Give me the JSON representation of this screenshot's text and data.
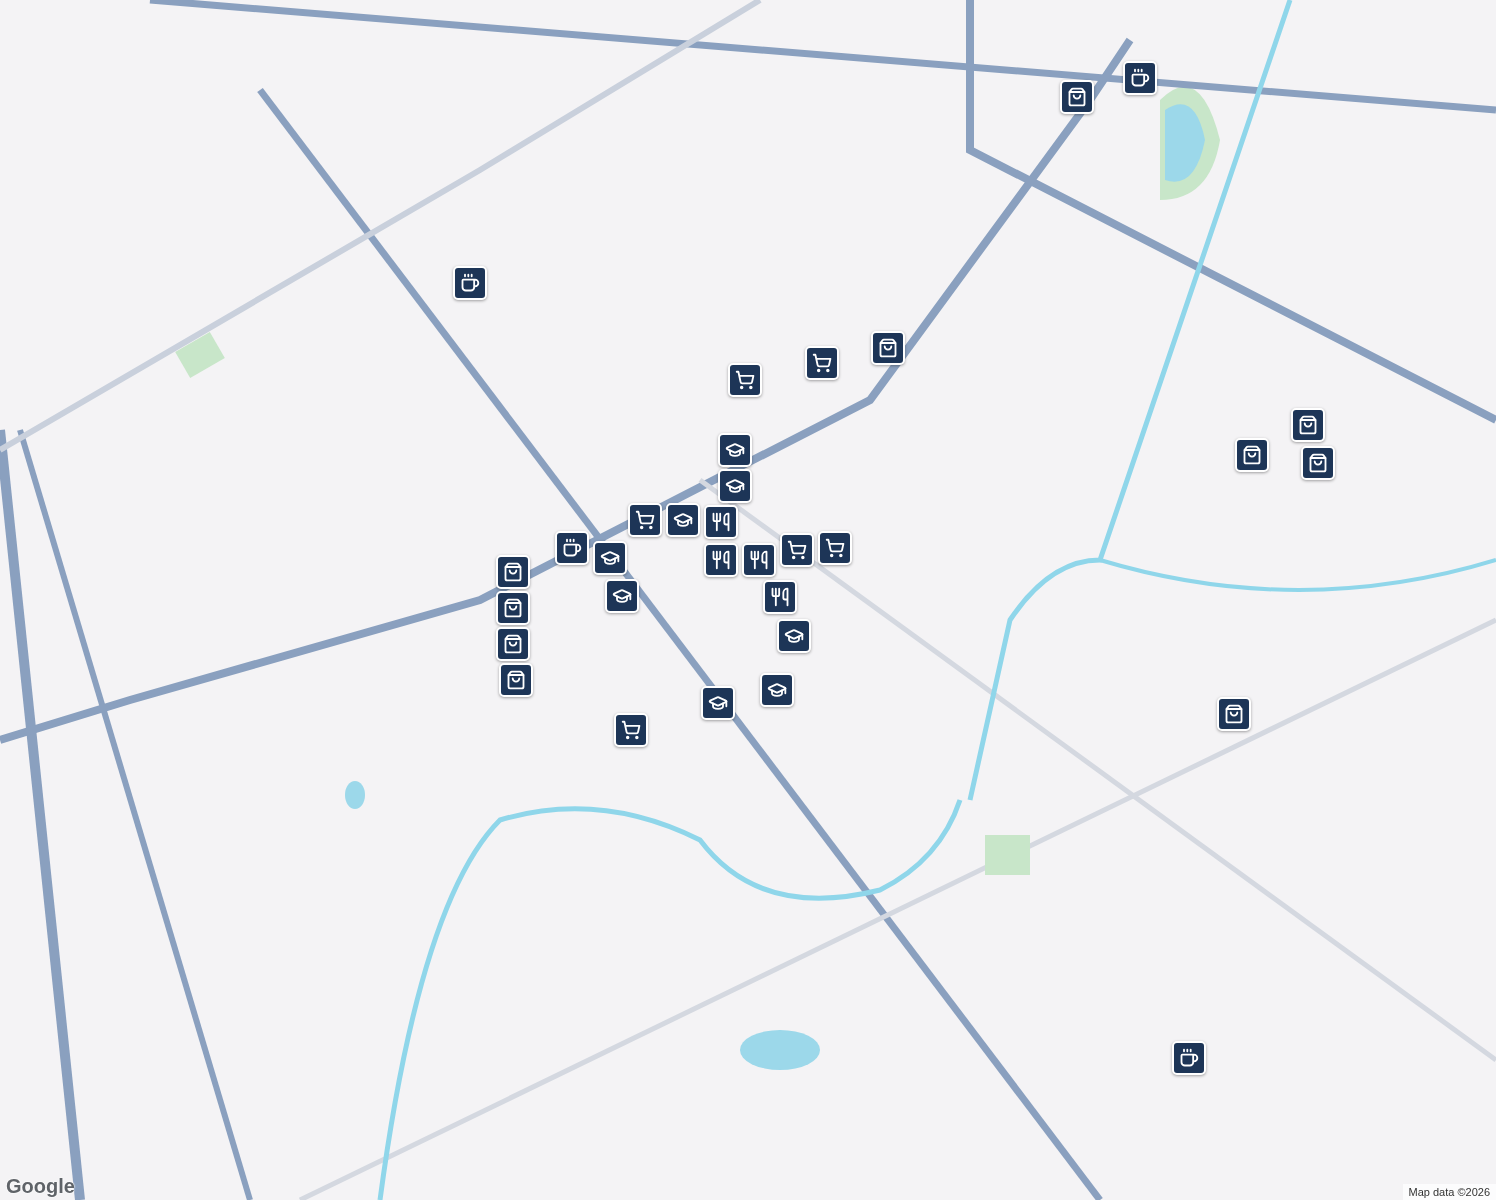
{
  "map": {
    "markers": [
      {
        "kind": "shopping"
      },
      {
        "kind": "coffee"
      },
      {
        "kind": "coffee"
      },
      {
        "kind": "shopping"
      },
      {
        "kind": "cart"
      },
      {
        "kind": "cart"
      },
      {
        "kind": "education"
      },
      {
        "kind": "education"
      },
      {
        "kind": "cart"
      },
      {
        "kind": "education"
      },
      {
        "kind": "restaurant"
      },
      {
        "kind": "restaurant"
      },
      {
        "kind": "restaurant"
      },
      {
        "kind": "cart"
      },
      {
        "kind": "cart"
      },
      {
        "kind": "restaurant"
      },
      {
        "kind": "coffee"
      },
      {
        "kind": "education"
      },
      {
        "kind": "education"
      },
      {
        "kind": "shopping"
      },
      {
        "kind": "shopping"
      },
      {
        "kind": "shopping"
      },
      {
        "kind": "shopping"
      },
      {
        "kind": "cart"
      },
      {
        "kind": "education"
      },
      {
        "kind": "education"
      },
      {
        "kind": "education"
      },
      {
        "kind": "shopping"
      },
      {
        "kind": "shopping"
      },
      {
        "kind": "shopping"
      },
      {
        "kind": "shopping"
      },
      {
        "kind": "coffee"
      }
    ]
  },
  "logo": "Google",
  "attribution": "Map data ©2026"
}
